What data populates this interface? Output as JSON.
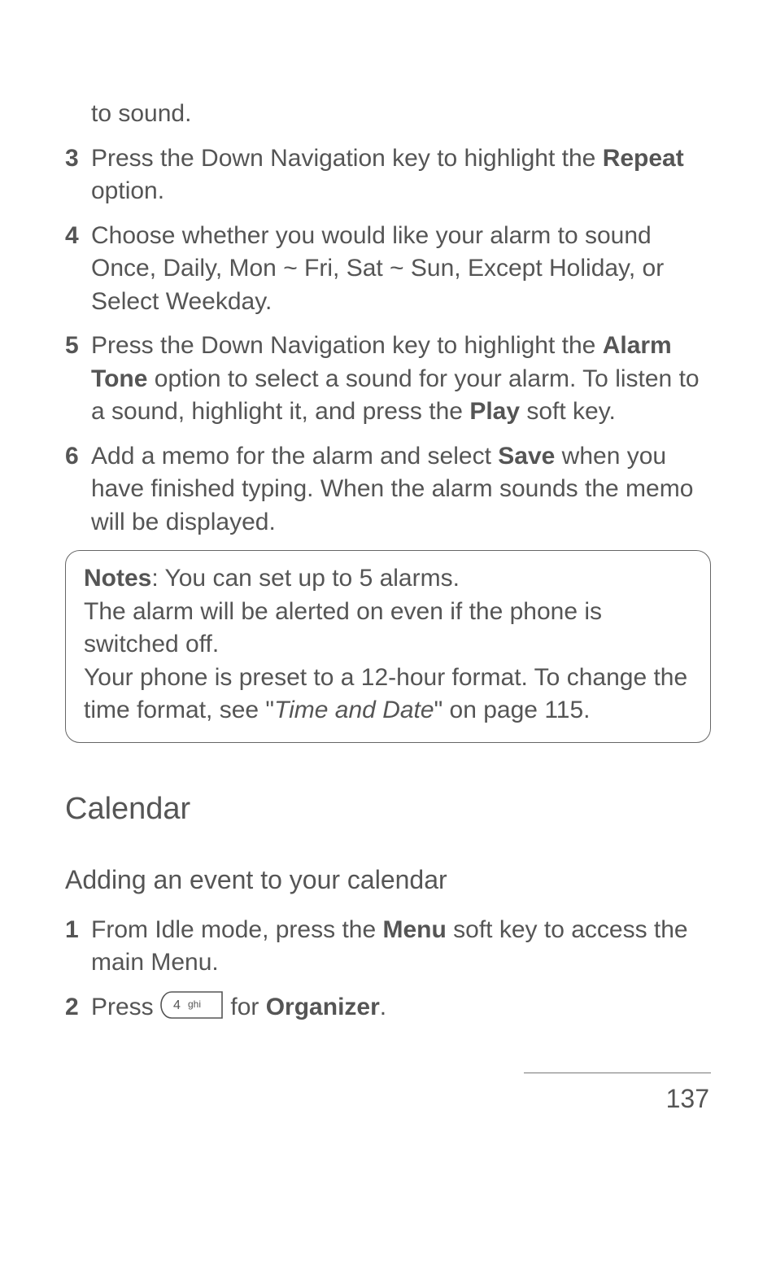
{
  "continuation": "to sound.",
  "steps_a": [
    {
      "num": "3",
      "pre": "Press the Down Navigation key to highlight the ",
      "bold": "Repeat",
      "post": " option."
    },
    {
      "num": "4",
      "text": "Choose whether you would like your alarm to sound Once, Daily, Mon ~ Fri, Sat ~ Sun, Except Holiday, or Select Weekday."
    },
    {
      "num": "5",
      "pre": "Press the Down Navigation key to highlight the ",
      "bold": "Alarm Tone",
      "mid": " option to select a sound for your alarm. To listen to a sound, highlight it, and press the ",
      "bold2": "Play",
      "post": " soft key."
    },
    {
      "num": "6",
      "pre": "Add a memo for the alarm and select ",
      "bold": "Save",
      "post": " when you have finished typing. When the alarm sounds the memo will be displayed."
    }
  ],
  "note": {
    "label": "Notes",
    "line1": ": You can set up to 5 alarms.",
    "line2": "The alarm will be alerted on even if the phone is switched off.",
    "line3_a": "Your phone is preset to a 12-hour format. To change the time format, see \"",
    "line3_i": "Time and Date",
    "line3_b": "\" on page 115."
  },
  "h2": "Calendar",
  "h3": "Adding an event to your calendar",
  "steps_b": [
    {
      "num": "1",
      "pre": "From Idle mode, press the ",
      "bold": "Menu",
      "post": " soft key to access the main Menu."
    },
    {
      "num": "2",
      "pre": "Press ",
      "key": "4 ghi",
      "mid": " for ",
      "bold": "Organizer",
      "post": "."
    }
  ],
  "page_num": "137"
}
